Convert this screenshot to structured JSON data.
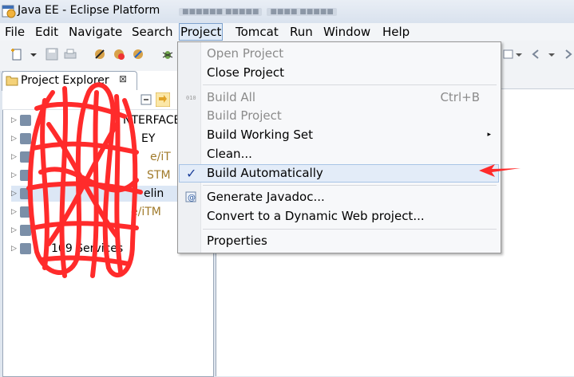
{
  "window": {
    "title": "Java EE - Eclipse Platform",
    "title_blur": [
      "■■■■■■  ■■■■■",
      "■■■■ ■■■■■"
    ]
  },
  "menubar": {
    "items": [
      "File",
      "Edit",
      "Navigate",
      "Search",
      "Project",
      "Tomcat",
      "Run",
      "Window",
      "Help"
    ],
    "active": "Project"
  },
  "project_explorer": {
    "tab_title": "Project Explorer",
    "close_glyph": "⊠",
    "rows": [
      "NTERFACE [",
      "EY",
      "e/iT",
      "STM",
      "elin",
      "e/iTM",
      "",
      "109  Services"
    ]
  },
  "project_menu": {
    "items": [
      {
        "label": "Open Project",
        "disabled": true
      },
      {
        "label": "Close Project",
        "disabled": false
      },
      {
        "label": "Build All",
        "accel": "Ctrl+B",
        "disabled": true,
        "icon": "binary-icon"
      },
      {
        "label": "Build Project",
        "disabled": true
      },
      {
        "label": "Build Working Set",
        "submenu": true,
        "disabled": false
      },
      {
        "label": "Clean...",
        "disabled": false
      },
      {
        "label": "Build Automatically",
        "checked": true,
        "disabled": false
      },
      {
        "label": "Generate Javadoc...",
        "disabled": false,
        "icon": "javadoc-icon"
      },
      {
        "label": "Convert to a Dynamic Web project...",
        "disabled": false
      },
      {
        "label": "Properties",
        "disabled": false
      }
    ],
    "check_glyph": "✓",
    "submenu_glyph": "▸"
  },
  "colors": {
    "annotation_red": "#ff2b2b",
    "check_blue": "#1b3f9a"
  }
}
